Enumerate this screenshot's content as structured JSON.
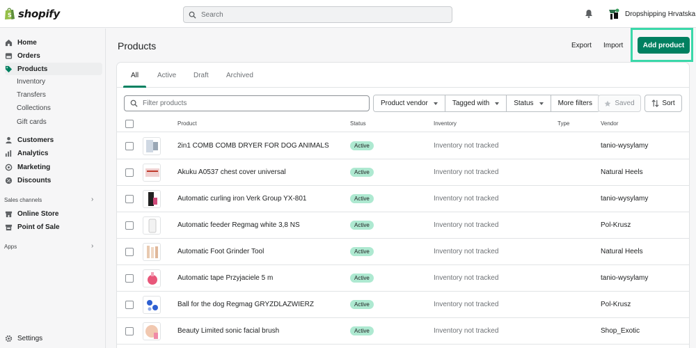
{
  "topbar": {
    "logo_text": "shopify",
    "search_placeholder": "Search",
    "store_name": "Dropshipping Hrvatska"
  },
  "sidebar": {
    "items": [
      {
        "label": "Home",
        "icon": "home-icon"
      },
      {
        "label": "Orders",
        "icon": "orders-icon"
      },
      {
        "label": "Products",
        "icon": "tag-icon",
        "active": true
      },
      {
        "label": "Customers",
        "icon": "person-icon"
      },
      {
        "label": "Analytics",
        "icon": "analytics-icon"
      },
      {
        "label": "Marketing",
        "icon": "marketing-icon"
      },
      {
        "label": "Discounts",
        "icon": "discount-icon"
      }
    ],
    "product_subitems": [
      "Inventory",
      "Transfers",
      "Collections",
      "Gift cards"
    ],
    "sales_channels_label": "Sales channels",
    "sales_channels": [
      {
        "label": "Online Store",
        "icon": "store-icon"
      },
      {
        "label": "Point of Sale",
        "icon": "pos-icon"
      }
    ],
    "apps_label": "Apps",
    "settings_label": "Settings"
  },
  "page": {
    "title": "Products",
    "export_label": "Export",
    "import_label": "Import",
    "add_product_label": "Add product"
  },
  "tabs": [
    "All",
    "Active",
    "Draft",
    "Archived"
  ],
  "filters": {
    "filter_placeholder": "Filter products",
    "product_vendor": "Product vendor",
    "tagged_with": "Tagged with",
    "status": "Status",
    "more_filters": "More filters",
    "saved": "Saved",
    "sort": "Sort"
  },
  "table": {
    "headers": {
      "product": "Product",
      "status": "Status",
      "inventory": "Inventory",
      "type": "Type",
      "vendor": "Vendor"
    },
    "rows": [
      {
        "name": "2in1 COMB COMB DRYER FOR DOG ANIMALS",
        "status": "Active",
        "inventory": "Inventory not tracked",
        "type": "",
        "vendor": "tanio-wysylamy"
      },
      {
        "name": "Akuku A0537 chest cover universal",
        "status": "Active",
        "inventory": "Inventory not tracked",
        "type": "",
        "vendor": "Natural Heels"
      },
      {
        "name": "Automatic curling iron Verk Group YX-801",
        "status": "Active",
        "inventory": "Inventory not tracked",
        "type": "",
        "vendor": "tanio-wysylamy"
      },
      {
        "name": "Automatic feeder Regmag white 3,8 NS",
        "status": "Active",
        "inventory": "Inventory not tracked",
        "type": "",
        "vendor": "Pol-Krusz"
      },
      {
        "name": "Automatic Foot Grinder Tool",
        "status": "Active",
        "inventory": "Inventory not tracked",
        "type": "",
        "vendor": "Natural Heels"
      },
      {
        "name": "Automatic tape Przyjaciele 5 m",
        "status": "Active",
        "inventory": "Inventory not tracked",
        "type": "",
        "vendor": "tanio-wysylamy"
      },
      {
        "name": "Ball for the dog Regmag GRYZDLAZWIERZ",
        "status": "Active",
        "inventory": "Inventory not tracked",
        "type": "",
        "vendor": "Pol-Krusz"
      },
      {
        "name": "Beauty Limited sonic facial brush",
        "status": "Active",
        "inventory": "Inventory not tracked",
        "type": "",
        "vendor": "Shop_Exotic"
      }
    ]
  },
  "colors": {
    "primary_button": "#008060",
    "highlight_outline": "#3ad8a9",
    "active_badge": "#aee9d1"
  }
}
